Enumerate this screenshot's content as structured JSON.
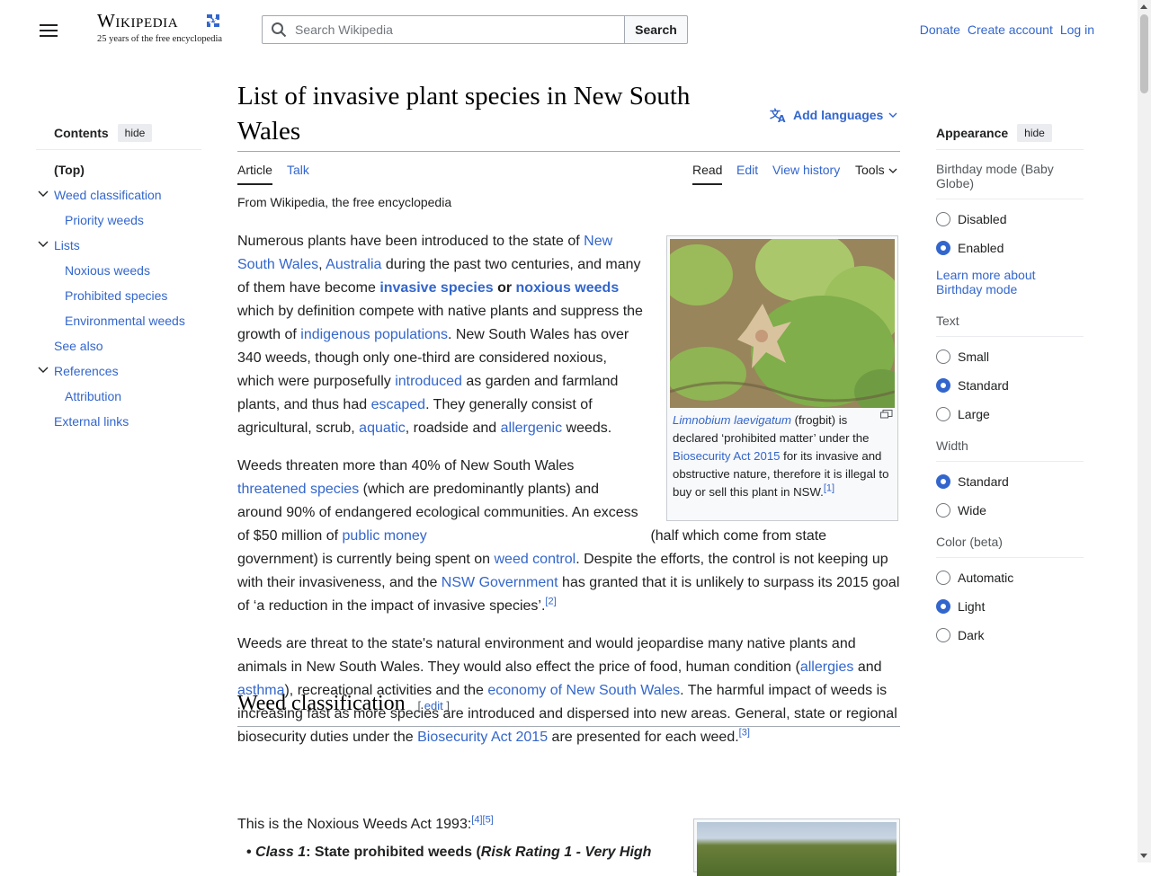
{
  "header": {
    "logo_word": "Wikipedia",
    "logo_tagline": "25 years of the free encyclopedia",
    "search_placeholder": "Search Wikipedia",
    "search_button": "Search",
    "user_links": [
      "Donate",
      "Create account",
      "Log in"
    ]
  },
  "toc": {
    "title": "Contents",
    "hide": "hide",
    "items": [
      {
        "label": "(Top)"
      },
      {
        "label": "Weed classification"
      },
      {
        "label": "Priority weeds"
      },
      {
        "label": "Lists"
      },
      {
        "label": "Noxious weeds"
      },
      {
        "label": "Prohibited species"
      },
      {
        "label": "Environmental weeds"
      },
      {
        "label": "See also"
      },
      {
        "label": "References"
      },
      {
        "label": "Attribution"
      },
      {
        "label": "External links"
      }
    ]
  },
  "article": {
    "title": "List of invasive plant species in New South Wales",
    "add_languages": "Add languages",
    "tabs": {
      "article": "Article",
      "talk": "Talk",
      "read": "Read",
      "edit": "Edit",
      "history": "View history",
      "tools": "Tools"
    },
    "subtitle": "From Wikipedia, the free encyclopedia",
    "p1": {
      "t1": "Numerous plants have been introduced to the state of ",
      "l1": "New South Wales",
      "t2": ", ",
      "l2": "Australia",
      "t3": " during the past two centuries, and many of them have become ",
      "l3": "invasive species",
      "t4": " or ",
      "l4": "noxious weeds",
      "t5": " which by definition compete with native plants and suppress the growth of ",
      "l5": "indigenous populations",
      "t6": ". New South Wales has over 340 weeds, though only one-third are considered noxious, which were purposefully ",
      "l6": "introduced",
      "t7": " as garden and farmland plants, and thus had ",
      "l7": "escaped",
      "t8": ". They generally consist of agricultural, scrub, ",
      "l8": "aquatic",
      "t9": ", roadside and ",
      "l9": "allergenic",
      "t10": " weeds."
    },
    "p2": {
      "t1": "Weeds threaten more than 40% of New South Wales ",
      "l1": "threatened species",
      "t2": " (which are predominantly plants) and around 90% of endangered ecological communities. An excess of $50 million of ",
      "l2": "public money",
      "t3": " (half which come from state government) is currently being spent on ",
      "l3": "weed control",
      "t4": ". Despite the efforts, the control is not keeping up with their invasiveness, and the ",
      "l4": "NSW Government",
      "t5": " has granted that it is unlikely to surpass its 2015 goal of ‘a reduction in the impact of invasive species’.",
      "ref": "[2]"
    },
    "p3": {
      "t1": "Weeds are threat to the state's natural environment and would jeopardise many native plants and animals in New South Wales. They would also effect the price of food, human condition (",
      "l1": "allergies",
      "t2": " and ",
      "l2": "asthma",
      "t3": "), recreational activities and the ",
      "l3": "economy of New South Wales",
      "t4": ". The harmful impact of weeds is increasing fast as more species are introduced and dispersed into new areas. General, state or regional biosecurity duties under the ",
      "l4": "Biosecurity Act 2015",
      "t5": " are presented for each weed.",
      "ref": "[3]"
    },
    "figure": {
      "species": "Limnobium laevigatum",
      "c1": " (frogbit) is declared ‘prohibited matter’ under the ",
      "act": "Biosecurity Act 2015",
      "c2": " for its invasive and obstructive nature, therefore it is illegal to buy or sell this plant in NSW.",
      "ref": "[1]"
    },
    "section": {
      "heading": "Weed classification",
      "edit_open": "[ ",
      "edit": "edit",
      "edit_close": " ]",
      "intro": "This is the Noxious Weeds Act 1993:",
      "refs": "[4][5]",
      "bullet_class": "Class 1",
      "bullet_text": ": State prohibited weeds (",
      "bullet_risk": "Risk Rating 1 - Very High"
    }
  },
  "appearance": {
    "title": "Appearance",
    "hide": "hide",
    "birthday_label": "Birthday mode (Baby Globe)",
    "birthday_options": [
      "Disabled",
      "Enabled"
    ],
    "birthday_selected": "Enabled",
    "learn_more": "Learn more about Birthday mode",
    "text_label": "Text",
    "text_options": [
      "Small",
      "Standard",
      "Large"
    ],
    "text_selected": "Standard",
    "width_label": "Width",
    "width_options": [
      "Standard",
      "Wide"
    ],
    "width_selected": "Standard",
    "color_label": "Color (beta)",
    "color_options": [
      "Automatic",
      "Light",
      "Dark"
    ],
    "color_selected": "Light"
  },
  "colors": {
    "link": "#3366cc",
    "text": "#202122",
    "radio_selected": "#3366cc"
  }
}
